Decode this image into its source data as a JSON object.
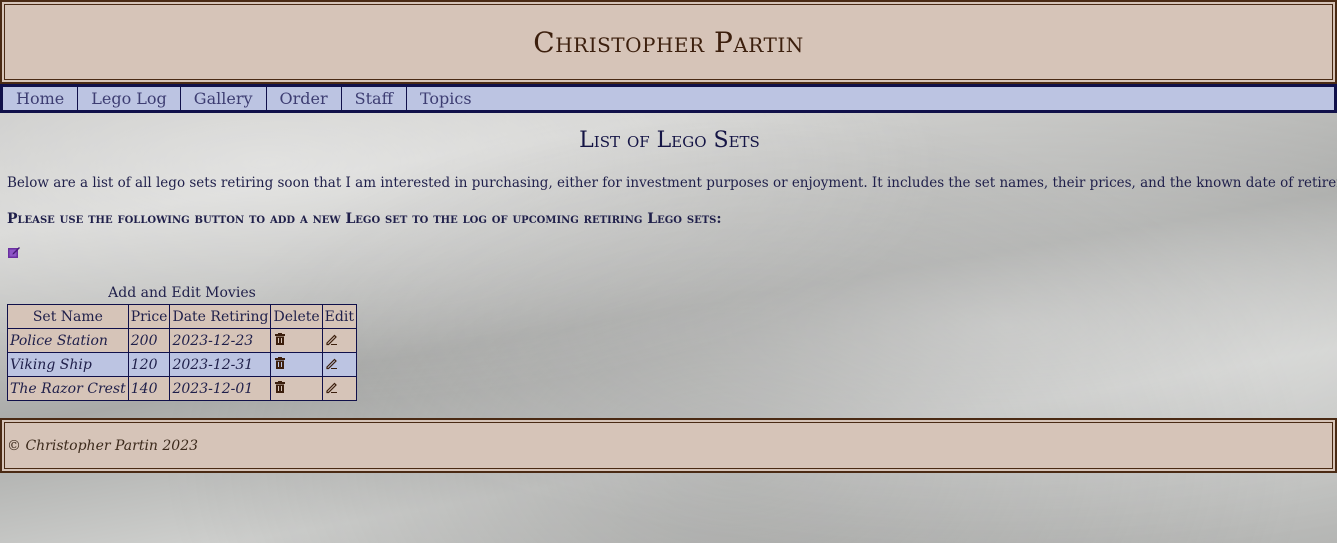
{
  "site": {
    "title": "Christopher Partin"
  },
  "nav": {
    "items": [
      {
        "label": "Home"
      },
      {
        "label": "Lego Log"
      },
      {
        "label": "Gallery"
      },
      {
        "label": "Order"
      },
      {
        "label": "Staff"
      },
      {
        "label": "Topics"
      }
    ]
  },
  "main": {
    "heading": "List of Lego Sets",
    "intro": "Below are a list of all lego sets retiring soon that I am interested in purchasing, either for investment purposes or enjoyment. It includes the set names, their prices, and the known date of retirement.",
    "instruction": "Please use the following button to add a new Lego set to the log of upcoming retiring Lego sets:",
    "add_icon": "add-note-icon"
  },
  "table": {
    "caption": "Add and Edit Movies",
    "headers": [
      "Set Name",
      "Price",
      "Date Retiring",
      "Delete",
      "Edit"
    ],
    "rows": [
      {
        "name": "Police Station",
        "price": "200",
        "date": "2023-12-23"
      },
      {
        "name": "Viking Ship",
        "price": "120",
        "date": "2023-12-31"
      },
      {
        "name": "The Razor Crest",
        "price": "140",
        "date": "2023-12-01"
      }
    ],
    "delete_icon": "trash-icon",
    "edit_icon": "pencil-icon"
  },
  "footer": {
    "text": "© Christopher Partin 2023"
  },
  "colors": {
    "header_bg": "#d6c4b8",
    "nav_bg": "#bcc4e2",
    "border_dark": "#10104a",
    "brown_border": "#4a2a14"
  }
}
